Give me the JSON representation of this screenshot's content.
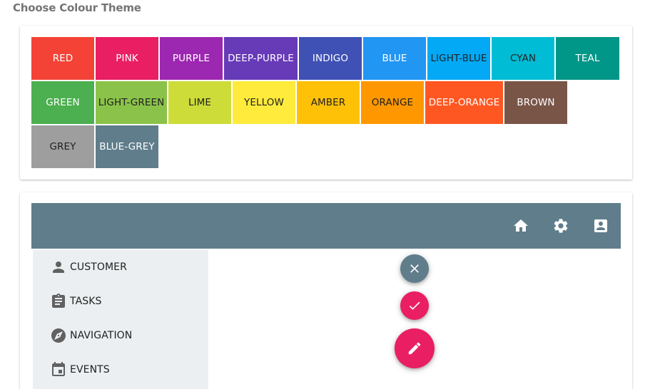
{
  "page": {
    "heading": "Choose Colour Theme"
  },
  "theme_swatches": [
    {
      "label": "RED",
      "color": "#f44336",
      "text": "light"
    },
    {
      "label": "PINK",
      "color": "#e91e63",
      "text": "light"
    },
    {
      "label": "PURPLE",
      "color": "#9c27b0",
      "text": "light"
    },
    {
      "label": "DEEP-PURPLE",
      "color": "#673ab7",
      "text": "light"
    },
    {
      "label": "INDIGO",
      "color": "#3f51b5",
      "text": "light"
    },
    {
      "label": "BLUE",
      "color": "#2196f3",
      "text": "light"
    },
    {
      "label": "LIGHT-BLUE",
      "color": "#03a9f4",
      "text": "dark"
    },
    {
      "label": "CYAN",
      "color": "#00bcd4",
      "text": "dark"
    },
    {
      "label": "TEAL",
      "color": "#009688",
      "text": "light"
    },
    {
      "label": "GREEN",
      "color": "#4caf50",
      "text": "light"
    },
    {
      "label": "LIGHT-GREEN",
      "color": "#8bc34a",
      "text": "dark"
    },
    {
      "label": "LIME",
      "color": "#cddc39",
      "text": "dark"
    },
    {
      "label": "YELLOW",
      "color": "#ffeb3b",
      "text": "dark"
    },
    {
      "label": "AMBER",
      "color": "#ffc107",
      "text": "dark"
    },
    {
      "label": "ORANGE",
      "color": "#ff9800",
      "text": "dark"
    },
    {
      "label": "DEEP-ORANGE",
      "color": "#ff5722",
      "text": "light"
    },
    {
      "label": "BROWN",
      "color": "#795548",
      "text": "light"
    },
    {
      "label": "GREY",
      "color": "#9e9e9e",
      "text": "dark"
    },
    {
      "label": "BLUE-GREY",
      "color": "#607d8b",
      "text": "light"
    }
  ],
  "preview": {
    "toolbar_color": "#607d8b",
    "toolbar_icons": [
      "home-icon",
      "settings-icon",
      "contact-card-icon"
    ],
    "sidenav_color": "#eceff1",
    "nav_items": [
      {
        "label": "CUSTOMER",
        "icon": "person-icon"
      },
      {
        "label": "TASKS",
        "icon": "assignment-icon"
      },
      {
        "label": "NAVIGATION",
        "icon": "compass-icon"
      },
      {
        "label": "EVENTS",
        "icon": "calendar-icon"
      }
    ],
    "fabs": [
      {
        "icon": "close-icon",
        "color": "#607d8b"
      },
      {
        "icon": "check-icon",
        "color": "#e91e63"
      },
      {
        "icon": "edit-icon",
        "color": "#e91e63"
      }
    ]
  }
}
